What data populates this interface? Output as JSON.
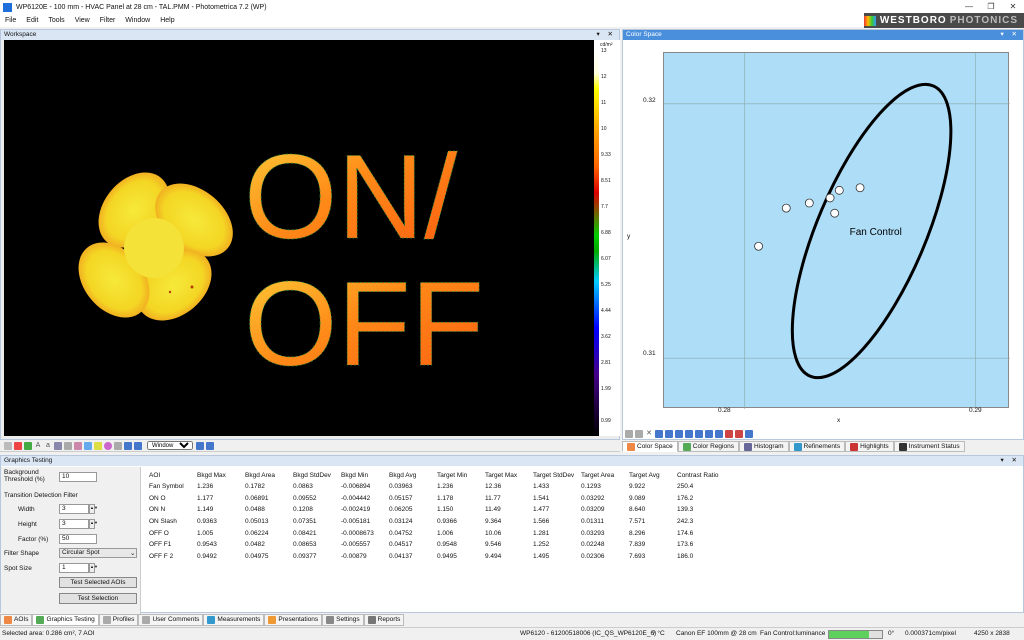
{
  "window": {
    "title": "WP6120E - 100 mm - HVAC Panel at 28 cm - TAL.PMM - Photometrica 7.2 (WP)"
  },
  "menu": [
    "File",
    "Edit",
    "Tools",
    "View",
    "Filter",
    "Window",
    "Help"
  ],
  "brand": {
    "name": "WESTBORO",
    "sub": "PHOTONICS"
  },
  "workspace": {
    "title": "Workspace",
    "image_text": {
      "line1": "ON/",
      "line2": "OFF"
    },
    "scale": {
      "unit": "cd/m²",
      "ticks": [
        "13",
        "12",
        "11",
        "10",
        "9.33",
        "8.51",
        "7.7",
        "6.88",
        "6.07",
        "5.25",
        "4.44",
        "3.62",
        "2.81",
        "1.99",
        "0.99"
      ]
    },
    "toolbar_select": "Window"
  },
  "color_space": {
    "title": "Color Space",
    "region_label": "Fan Control",
    "ylabel": "y",
    "xlabel": "x",
    "y_ticks": [
      "0.32",
      "0.31"
    ],
    "x_ticks": [
      "0.28",
      "0.29"
    ],
    "tabs": [
      "Color Space",
      "Color Regions",
      "Histogram",
      "Refinements",
      "Highlights",
      "Instrument Status"
    ]
  },
  "chart_data": {
    "type": "scatter",
    "xlabel": "x",
    "ylabel": "y",
    "xlim": [
      0.2765,
      0.2915
    ],
    "ylim": [
      0.308,
      0.322
    ],
    "points": [
      {
        "x": 0.2806,
        "y": 0.3144
      },
      {
        "x": 0.2818,
        "y": 0.3159
      },
      {
        "x": 0.2828,
        "y": 0.3161
      },
      {
        "x": 0.2837,
        "y": 0.3163
      },
      {
        "x": 0.2841,
        "y": 0.3166
      },
      {
        "x": 0.2839,
        "y": 0.3157
      },
      {
        "x": 0.285,
        "y": 0.3167
      }
    ],
    "region": {
      "name": "Fan Control",
      "cx": 0.2855,
      "cy": 0.315,
      "rx": 0.00235,
      "ry": 0.0062,
      "angle_deg": 23
    },
    "grid": true
  },
  "graphics_testing": {
    "title": "Graphics Testing",
    "bg_label": "Background Threshold (%)",
    "bg_value": "10",
    "tdf_label": "Transition Detection Filter",
    "width_label": "Width",
    "width_value": "3",
    "height_label": "Height",
    "height_value": "3",
    "factor_label": "Factor (%)",
    "factor_value": "50",
    "filter_shape_label": "Filter Shape",
    "filter_shape_value": "Circular Spot",
    "spot_size_label": "Spot Size",
    "spot_size_value": "1",
    "btn_test_selected": "Test Selected AOIs",
    "btn_test_selection": "Test Selection",
    "columns": [
      "AOI",
      "Bkgd Max",
      "Bkgd Area",
      "Bkgd StdDev",
      "Bkgd Min",
      "Bkgd Avg",
      "Target Min",
      "Target Max",
      "Target StdDev",
      "Target Area",
      "Target Avg",
      "Contrast Ratio"
    ],
    "rows": [
      [
        "Fan Symbol",
        "1.236",
        "0.1782",
        "0.0863",
        "-0.006894",
        "0.03963",
        "1.236",
        "12.36",
        "1.433",
        "0.1293",
        "9.922",
        "250.4"
      ],
      [
        "ON O",
        "1.177",
        "0.06891",
        "0.09552",
        "-0.004442",
        "0.05157",
        "1.178",
        "11.77",
        "1.541",
        "0.03292",
        "9.089",
        "176.2"
      ],
      [
        "ON N",
        "1.149",
        "0.0488",
        "0.1208",
        "-0.002419",
        "0.06205",
        "1.150",
        "11.49",
        "1.477",
        "0.03209",
        "8.640",
        "139.3"
      ],
      [
        "ON Slash",
        "0.9363",
        "0.05013",
        "0.07351",
        "-0.005181",
        "0.03124",
        "0.9366",
        "9.364",
        "1.566",
        "0.01311",
        "7.571",
        "242.3"
      ],
      [
        "OFF O",
        "1.005",
        "0.06224",
        "0.08421",
        "-0.0008673",
        "0.04752",
        "1.006",
        "10.06",
        "1.281",
        "0.03293",
        "8.296",
        "174.6"
      ],
      [
        "OFF F1",
        "0.9543",
        "0.0482",
        "0.08653",
        "-0.005557",
        "0.04517",
        "0.9548",
        "9.546",
        "1.252",
        "0.02248",
        "7.839",
        "173.6"
      ],
      [
        "OFF F 2",
        "0.9492",
        "0.04975",
        "0.09377",
        "-0.00879",
        "0.04137",
        "0.9495",
        "9.494",
        "1.495",
        "0.02306",
        "7.693",
        "186.0"
      ]
    ]
  },
  "bottom_tabs": [
    "AOIs",
    "Graphics Testing",
    "Profiles",
    "User Comments",
    "Measurements",
    "Presentations",
    "Settings",
    "Reports"
  ],
  "status": {
    "selected": "Selected area: 0.286 cm², 7 AOI",
    "device": "WP6120 - 61200518006 (IC_QS_WP6120E_6)",
    "temp": "? °C",
    "lens": "Canon EF 100mm @ 28 cm",
    "measure": "Fan Control:luminance",
    "progress": 0.75,
    "angle": "0°",
    "res": "0.000371cm/pixel",
    "size": "4250 x 2838"
  }
}
